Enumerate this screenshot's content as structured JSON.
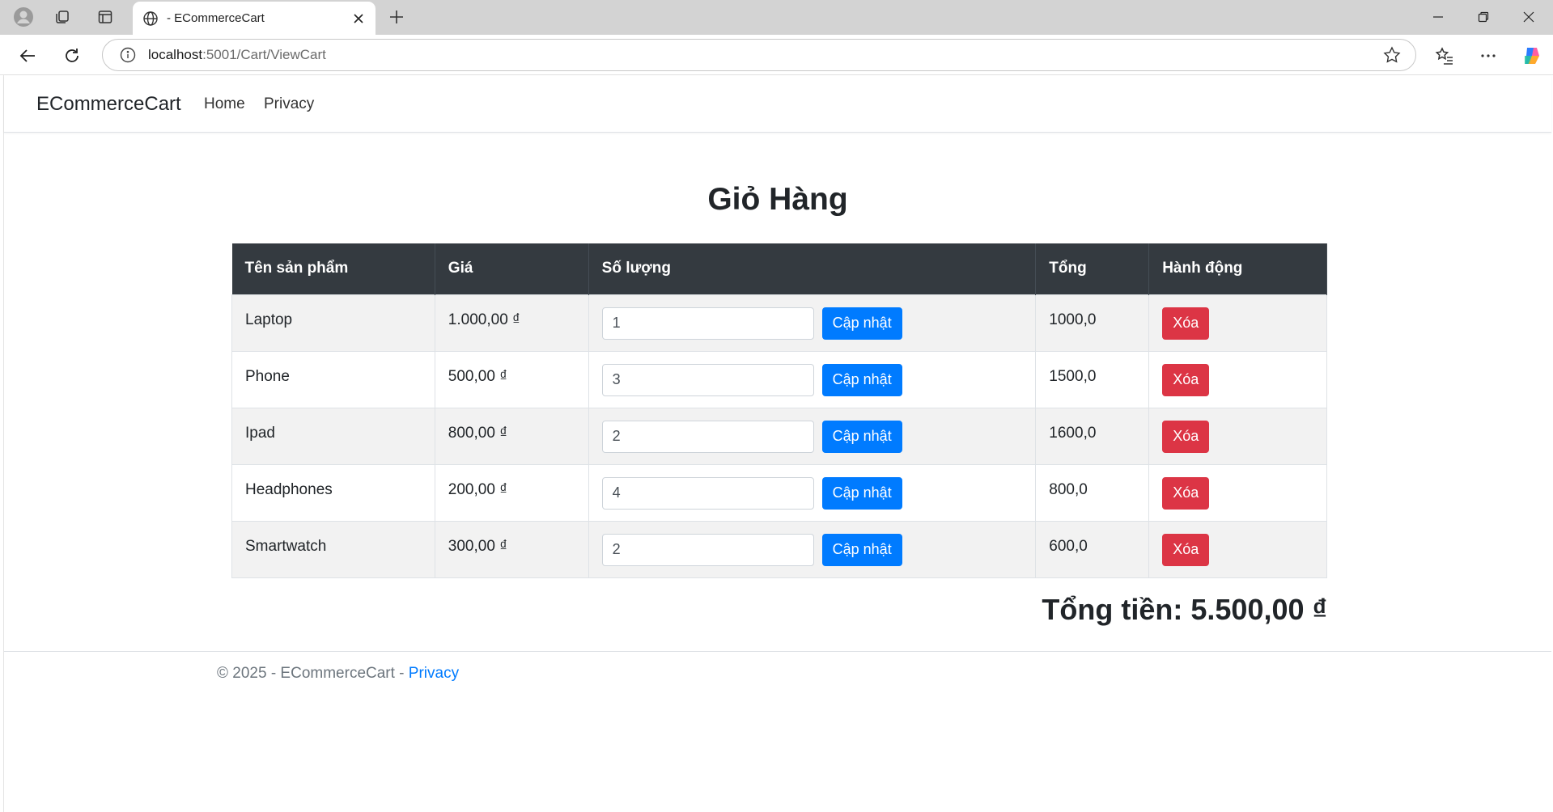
{
  "browser": {
    "tab_title": "- ECommerceCart",
    "url_host": "localhost",
    "url_path": ":5001/Cart/ViewCart"
  },
  "site": {
    "brand": "ECommerceCart",
    "nav": [
      {
        "label": "Home"
      },
      {
        "label": "Privacy"
      }
    ]
  },
  "cart": {
    "title": "Giỏ Hàng",
    "columns": [
      "Tên sản phẩm",
      "Giá",
      "Số lượng",
      "Tổng",
      "Hành động"
    ],
    "update_label": "Cập nhật",
    "delete_label": "Xóa",
    "rows": [
      {
        "name": "Laptop",
        "price": "1.000,00 ₫",
        "qty": "1",
        "total": "1000,0"
      },
      {
        "name": "Phone",
        "price": "500,00 ₫",
        "qty": "3",
        "total": "1500,0"
      },
      {
        "name": "Ipad",
        "price": "800,00 ₫",
        "qty": "2",
        "total": "1600,0"
      },
      {
        "name": "Headphones",
        "price": "200,00 ₫",
        "qty": "4",
        "total": "800,0"
      },
      {
        "name": "Smartwatch",
        "price": "300,00 ₫",
        "qty": "2",
        "total": "600,0"
      }
    ],
    "grand_total": "Tổng tiền: 5.500,00 ₫"
  },
  "footer": {
    "text": "© 2025 - ECommerceCart - ",
    "link": "Privacy"
  },
  "colors": {
    "header_bg": "#343a40",
    "primary": "#007bff",
    "danger": "#dc3545"
  }
}
